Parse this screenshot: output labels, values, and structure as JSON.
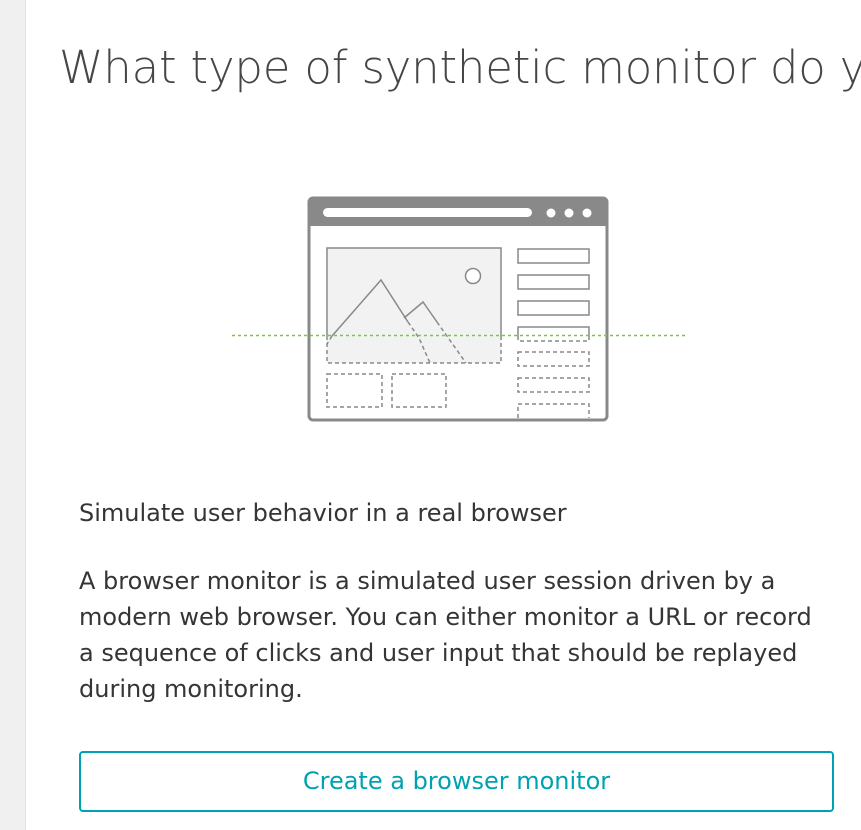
{
  "page": {
    "title": "What type of synthetic monitor do you"
  },
  "illustration": {
    "icon": "browser-window-illustration",
    "accent_line_color": "#7dc540",
    "frame_color": "#898989"
  },
  "option": {
    "subtitle": "Simulate user behavior in a real browser",
    "description": "A browser monitor is a simulated user session driven by a modern web browser. You can either monitor a URL or record a sequence of clicks and user input that should be replayed during monitoring.",
    "button_label": "Create a browser monitor",
    "accent_color": "#00a1b2"
  }
}
